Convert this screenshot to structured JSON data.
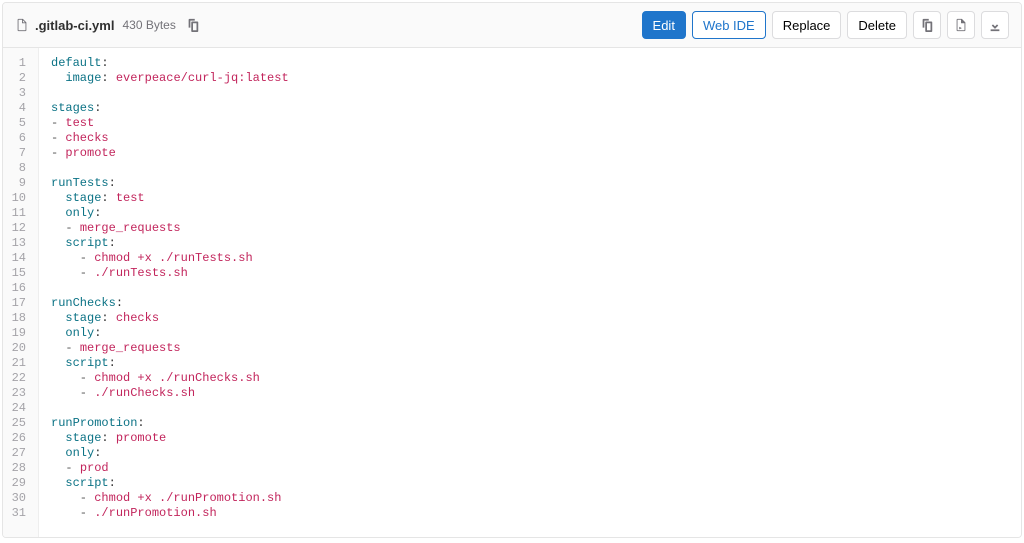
{
  "header": {
    "filename": ".gitlab-ci.yml",
    "filesize": "430 Bytes",
    "buttons": {
      "edit": "Edit",
      "web_ide": "Web IDE",
      "replace": "Replace",
      "delete": "Delete"
    }
  },
  "code": {
    "lines": [
      [
        {
          "t": "default",
          "c": "key"
        },
        {
          "t": ":",
          "c": ""
        }
      ],
      [
        {
          "t": "  ",
          "c": ""
        },
        {
          "t": "image",
          "c": "key"
        },
        {
          "t": ": ",
          "c": ""
        },
        {
          "t": "everpeace/curl-jq:latest",
          "c": "str"
        }
      ],
      [],
      [
        {
          "t": "stages",
          "c": "key"
        },
        {
          "t": ":",
          "c": ""
        }
      ],
      [
        {
          "t": "- ",
          "c": "dash"
        },
        {
          "t": "test",
          "c": "str"
        }
      ],
      [
        {
          "t": "- ",
          "c": "dash"
        },
        {
          "t": "checks",
          "c": "str"
        }
      ],
      [
        {
          "t": "- ",
          "c": "dash"
        },
        {
          "t": "promote",
          "c": "str"
        }
      ],
      [],
      [
        {
          "t": "runTests",
          "c": "key"
        },
        {
          "t": ":",
          "c": ""
        }
      ],
      [
        {
          "t": "  ",
          "c": ""
        },
        {
          "t": "stage",
          "c": "key"
        },
        {
          "t": ": ",
          "c": ""
        },
        {
          "t": "test",
          "c": "str"
        }
      ],
      [
        {
          "t": "  ",
          "c": ""
        },
        {
          "t": "only",
          "c": "key"
        },
        {
          "t": ":",
          "c": ""
        }
      ],
      [
        {
          "t": "  - ",
          "c": "dash"
        },
        {
          "t": "merge_requests",
          "c": "str"
        }
      ],
      [
        {
          "t": "  ",
          "c": ""
        },
        {
          "t": "script",
          "c": "key"
        },
        {
          "t": ":",
          "c": ""
        }
      ],
      [
        {
          "t": "    - ",
          "c": "dash"
        },
        {
          "t": "chmod +x ./runTests.sh",
          "c": "str"
        }
      ],
      [
        {
          "t": "    - ",
          "c": "dash"
        },
        {
          "t": "./runTests.sh",
          "c": "str"
        }
      ],
      [],
      [
        {
          "t": "runChecks",
          "c": "key"
        },
        {
          "t": ":",
          "c": ""
        }
      ],
      [
        {
          "t": "  ",
          "c": ""
        },
        {
          "t": "stage",
          "c": "key"
        },
        {
          "t": ": ",
          "c": ""
        },
        {
          "t": "checks",
          "c": "str"
        }
      ],
      [
        {
          "t": "  ",
          "c": ""
        },
        {
          "t": "only",
          "c": "key"
        },
        {
          "t": ":",
          "c": ""
        }
      ],
      [
        {
          "t": "  - ",
          "c": "dash"
        },
        {
          "t": "merge_requests",
          "c": "str"
        }
      ],
      [
        {
          "t": "  ",
          "c": ""
        },
        {
          "t": "script",
          "c": "key"
        },
        {
          "t": ":",
          "c": ""
        }
      ],
      [
        {
          "t": "    - ",
          "c": "dash"
        },
        {
          "t": "chmod +x ./runChecks.sh",
          "c": "str"
        }
      ],
      [
        {
          "t": "    - ",
          "c": "dash"
        },
        {
          "t": "./runChecks.sh",
          "c": "str"
        }
      ],
      [],
      [
        {
          "t": "runPromotion",
          "c": "key"
        },
        {
          "t": ":",
          "c": ""
        }
      ],
      [
        {
          "t": "  ",
          "c": ""
        },
        {
          "t": "stage",
          "c": "key"
        },
        {
          "t": ": ",
          "c": ""
        },
        {
          "t": "promote",
          "c": "str"
        }
      ],
      [
        {
          "t": "  ",
          "c": ""
        },
        {
          "t": "only",
          "c": "key"
        },
        {
          "t": ":",
          "c": ""
        }
      ],
      [
        {
          "t": "  - ",
          "c": "dash"
        },
        {
          "t": "prod",
          "c": "str"
        }
      ],
      [
        {
          "t": "  ",
          "c": ""
        },
        {
          "t": "script",
          "c": "key"
        },
        {
          "t": ":",
          "c": ""
        }
      ],
      [
        {
          "t": "    - ",
          "c": "dash"
        },
        {
          "t": "chmod +x ./runPromotion.sh",
          "c": "str"
        }
      ],
      [
        {
          "t": "    - ",
          "c": "dash"
        },
        {
          "t": "./runPromotion.sh",
          "c": "str"
        }
      ]
    ]
  }
}
